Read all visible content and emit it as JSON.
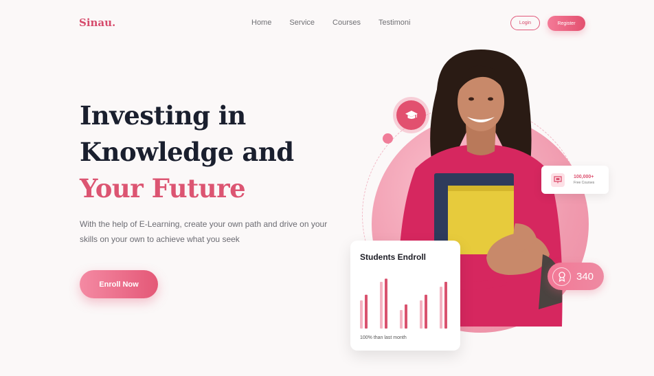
{
  "brand": {
    "name": "Sinau."
  },
  "nav": {
    "items": [
      "Home",
      "Service",
      "Courses",
      "Testimoni"
    ]
  },
  "auth": {
    "login": "Login",
    "register": "Register"
  },
  "hero": {
    "line1": "Investing in",
    "line2": "Knowledge and",
    "line3": "Your Future",
    "description": "With the help of E-Learning, create your own path and drive on your skills on your own to achieve what you seek",
    "cta": "Enroll Now"
  },
  "stats": {
    "courses_value": "100,000+",
    "courses_label": "Free Courses",
    "badge_value": "340"
  },
  "students_card": {
    "title": "Students Endroll",
    "footer": "100% than last month"
  },
  "chart_data": {
    "type": "bar",
    "series": [
      {
        "values": [
          35,
          58,
          23,
          35,
          52
        ]
      },
      {
        "values": [
          42,
          62,
          30,
          42,
          58
        ]
      }
    ],
    "ylim": [
      0,
      70
    ]
  },
  "colors": {
    "accent": "#e0587a",
    "dark": "#1a1f2e",
    "bar_light": "#f4b3c2",
    "bar_dark": "#d9536f"
  },
  "icons": [
    "graduation-cap-icon",
    "presentation-icon",
    "medal-icon"
  ]
}
